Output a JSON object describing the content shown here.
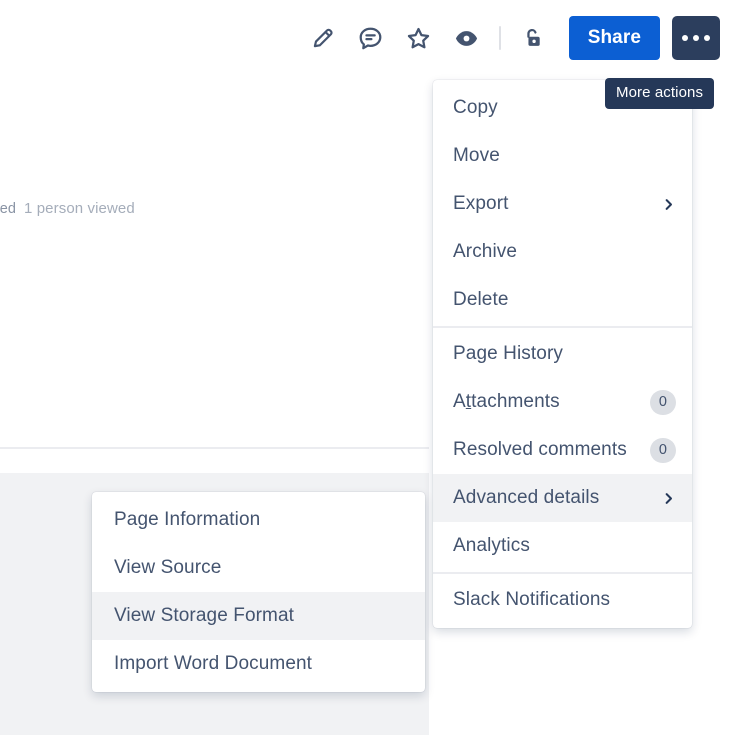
{
  "page": {
    "viewers_partial": "n viewed",
    "viewers_count": "1 person viewed"
  },
  "toolbar": {
    "icons": [
      {
        "name": "edit-icon",
        "title": "Edit"
      },
      {
        "name": "comment-icon",
        "title": "Comment"
      },
      {
        "name": "star-icon",
        "title": "Star"
      },
      {
        "name": "watch-eye-icon",
        "title": "Watch"
      },
      {
        "name": "unlock-restrictions-icon",
        "title": "Restrictions"
      }
    ],
    "share_label": "Share",
    "more_actions_label": "More actions",
    "colors": {
      "share_bg": "#0c5fd3",
      "more_bg": "#2c3e5d",
      "tooltip_bg": "#253858",
      "icon": "#44546f",
      "menu_text": "#44546f",
      "highlight": "#f1f2f4",
      "badge_bg": "#dcdfe4"
    }
  },
  "tooltip": {
    "text": "More actions"
  },
  "menu": {
    "groups": [
      {
        "items": [
          {
            "label": "Copy",
            "badge": null,
            "chevron": false,
            "selected": false
          },
          {
            "label": "Move",
            "badge": null,
            "chevron": false,
            "selected": false
          },
          {
            "label": "Export",
            "badge": null,
            "chevron": true,
            "selected": false
          },
          {
            "label": "Archive",
            "badge": null,
            "chevron": false,
            "selected": false
          },
          {
            "label": "Delete",
            "badge": null,
            "chevron": false,
            "selected": false
          }
        ]
      },
      {
        "items": [
          {
            "label": "Page History",
            "badge": null,
            "chevron": false,
            "selected": false
          },
          {
            "label": "Attachments",
            "badge": "0",
            "chevron": false,
            "selected": false,
            "accesskey": "t"
          },
          {
            "label": "Resolved comments",
            "badge": "0",
            "chevron": false,
            "selected": false
          },
          {
            "label": "Advanced details",
            "badge": null,
            "chevron": true,
            "selected": true
          },
          {
            "label": "Analytics",
            "badge": null,
            "chevron": false,
            "selected": false
          }
        ]
      },
      {
        "items": [
          {
            "label": "Slack Notifications",
            "badge": null,
            "chevron": false,
            "selected": false
          }
        ]
      }
    ]
  },
  "submenu": {
    "items": [
      {
        "label": "Page Information",
        "selected": false
      },
      {
        "label": "View Source",
        "selected": false
      },
      {
        "label": "View Storage Format",
        "selected": true
      },
      {
        "label": "Import Word Document",
        "selected": false
      }
    ]
  }
}
